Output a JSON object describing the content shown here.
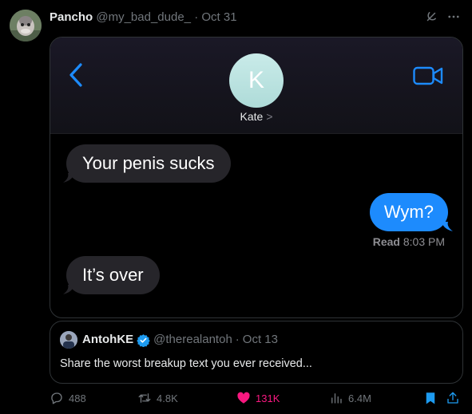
{
  "post": {
    "author_name": "Pancho",
    "handle": "@my_bad_dude_",
    "separator": "·",
    "date": "Oct 31"
  },
  "imessage": {
    "contact_initial": "K",
    "contact_name": "Kate",
    "contact_chevron": ">",
    "messages": [
      {
        "direction": "in",
        "text": "Your penis sucks"
      },
      {
        "direction": "out",
        "text": "Wym?"
      },
      {
        "direction": "in",
        "text": "It’s over"
      }
    ],
    "read_label": "Read",
    "read_time": "8:03 PM"
  },
  "quote": {
    "author_name": "AntohKE",
    "handle": "@therealantoh",
    "separator": "·",
    "date": "Oct 13",
    "text": "Share the worst breakup text you ever received..."
  },
  "actions": {
    "replies": "488",
    "reposts": "4.8K",
    "likes": "131K",
    "views": "6.4M"
  },
  "colors": {
    "background": "#000000",
    "bubble_in": "#26252a",
    "bubble_out": "#1d8bfd",
    "ios_blue": "#1d8bfd",
    "like_pink": "#f91880",
    "verified_blue": "#1d9bf0"
  },
  "icons": {
    "back": "chevron-left-icon",
    "video": "video-camera-icon",
    "grok": "grok-icon",
    "more": "more-horizontal-icon",
    "reply": "reply-icon",
    "repost": "repost-icon",
    "like": "heart-icon",
    "views": "views-chart-icon",
    "bookmark": "bookmark-icon",
    "share": "share-icon",
    "verified": "verified-badge-icon"
  }
}
